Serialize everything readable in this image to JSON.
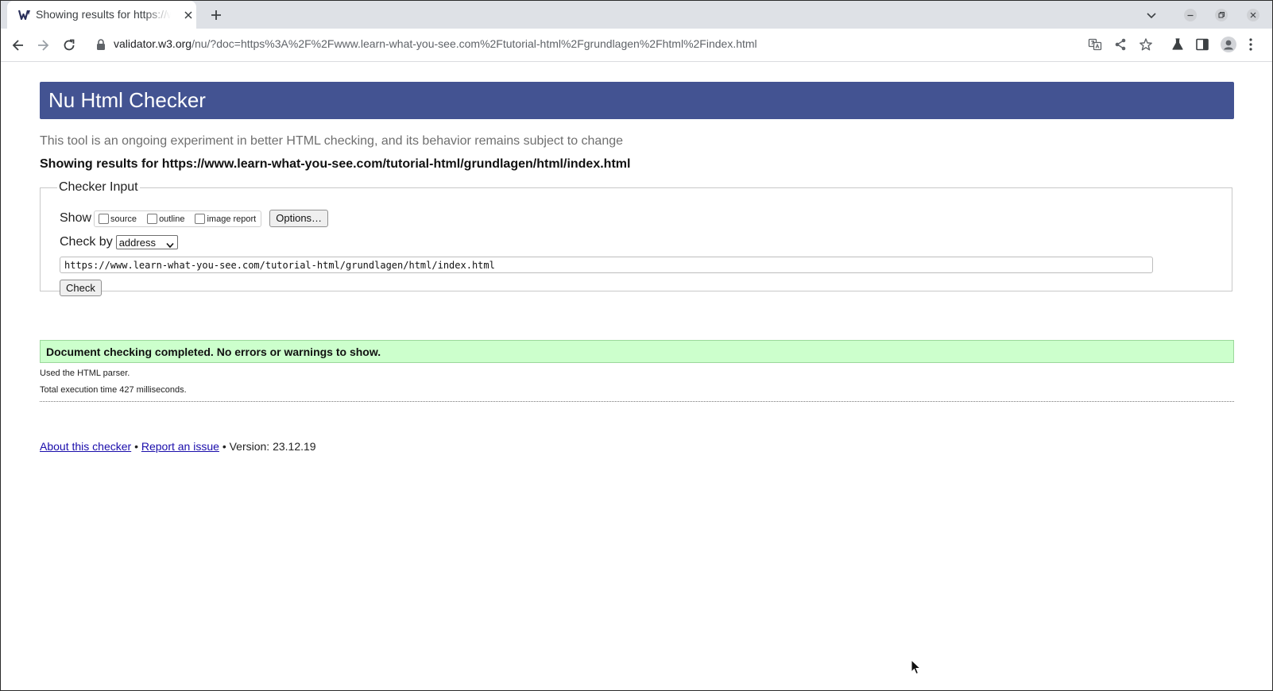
{
  "browser": {
    "tab": {
      "title": "Showing results for https://www.learn-what-you-see.com/tutorial-html/grundlagen/html/index.html"
    },
    "address_bar": {
      "host": "validator.w3.org",
      "path": "/nu/?doc=https%3A%2F%2Fwww.learn-what-you-see.com%2Ftutorial-html%2Fgrundlagen%2Fhtml%2Findex.html"
    },
    "icons": {
      "favicon": "w3c-validator-favicon",
      "new_tab": "plus-icon",
      "back": "arrow-left-icon",
      "forward": "arrow-right-icon",
      "reload": "reload-icon",
      "lock": "lock-icon",
      "translate": "translate-icon",
      "share": "share-icon",
      "bookmark": "star-icon",
      "labs": "flask-icon",
      "side_panel": "side-panel-icon",
      "profile": "profile-icon",
      "menu": "kebab-menu-icon"
    }
  },
  "page": {
    "banner_title": "Nu Html Checker",
    "tagline": "This tool is an ongoing experiment in better HTML checking, and its behavior remains subject to change",
    "results_for": "Showing results for https://www.learn-what-you-see.com/tutorial-html/grundlagen/html/index.html",
    "checker_input": {
      "legend": "Checker Input",
      "show_label": "Show",
      "options": [
        {
          "label": "source",
          "checked": false
        },
        {
          "label": "outline",
          "checked": false
        },
        {
          "label": "image report",
          "checked": false
        }
      ],
      "options_button": "Options…",
      "check_by_label": "Check by",
      "check_by_value": "address",
      "url_value": "https://www.learn-what-you-see.com/tutorial-html/grundlagen/html/index.html",
      "check_button": "Check"
    },
    "result": {
      "success_message": "Document checking completed. No errors or warnings to show.",
      "parser_note": "Used the HTML parser.",
      "exec_time": "Total execution time 427 milliseconds."
    },
    "footer": {
      "about_link": "About this checker",
      "separator": "•",
      "report_link": "Report an issue",
      "version": "Version: 23.12.19"
    },
    "colors": {
      "banner": "#435392",
      "success_bg": "#ccffcc",
      "link": "#1a0dab"
    }
  }
}
